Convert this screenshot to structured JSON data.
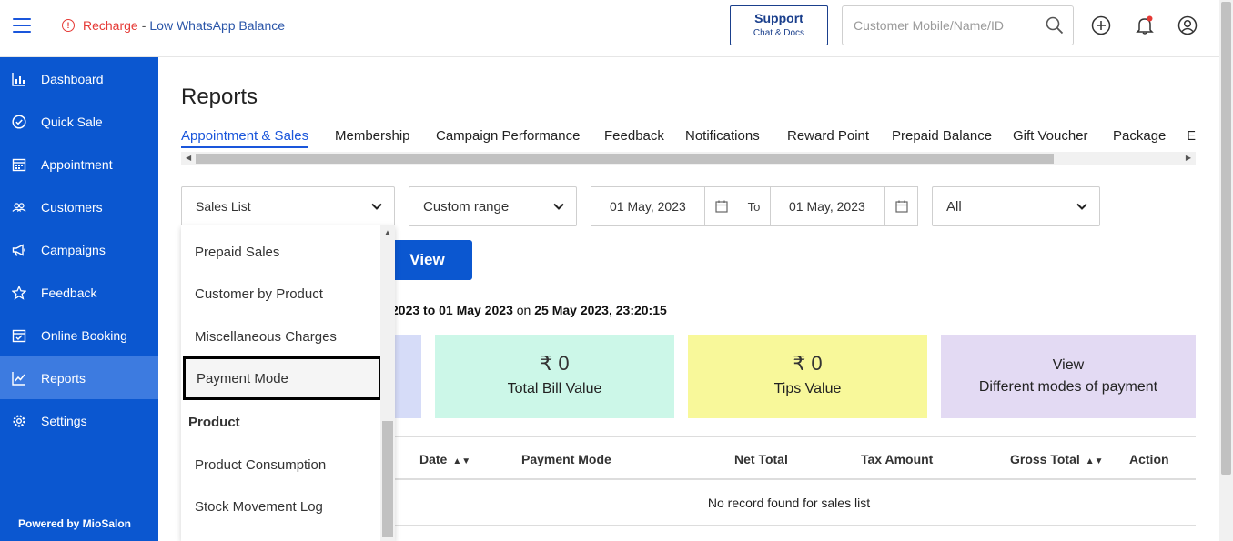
{
  "alert": {
    "prefix": "Recharge",
    "separator": "-",
    "text": "Low WhatsApp Balance"
  },
  "support": {
    "title": "Support",
    "subtitle": "Chat & Docs"
  },
  "search": {
    "placeholder": "Customer Mobile/Name/ID"
  },
  "sidebar": {
    "items": [
      {
        "label": "Dashboard",
        "icon": "bar-chart-icon"
      },
      {
        "label": "Quick Sale",
        "icon": "check-circle-icon"
      },
      {
        "label": "Appointment",
        "icon": "calendar-icon"
      },
      {
        "label": "Customers",
        "icon": "users-icon"
      },
      {
        "label": "Campaigns",
        "icon": "megaphone-icon"
      },
      {
        "label": "Feedback",
        "icon": "star-icon"
      },
      {
        "label": "Online Booking",
        "icon": "calendar-check-icon"
      },
      {
        "label": "Reports",
        "icon": "trend-chart-icon",
        "active": true
      },
      {
        "label": "Settings",
        "icon": "gear-icon"
      }
    ],
    "footer": "Powered by MioSalon"
  },
  "main": {
    "title": "Reports",
    "tabs": [
      {
        "label": "Appointment & Sales",
        "active": true
      },
      {
        "label": "Membership"
      },
      {
        "label": "Campaign Performance"
      },
      {
        "label": "Feedback"
      },
      {
        "label": "Notifications"
      },
      {
        "label": "Reward Point"
      },
      {
        "label": "Prepaid Balance"
      },
      {
        "label": "Gift Voucher"
      },
      {
        "label": "Package"
      },
      {
        "label": "E"
      }
    ],
    "filters": {
      "report_type": "Sales List",
      "range_type": "Custom range",
      "from_date": "01 May, 2023",
      "to_label": "To",
      "to_date": "01 May, 2023",
      "staff": "All"
    },
    "view_button": "View",
    "range_info": {
      "text": "2023 to 01 May 2023",
      "on": "on",
      "timestamp": "25 May 2023, 23:20:15"
    },
    "cards": [
      {
        "amount": "₹ 0",
        "label": "Total Bill Value",
        "color": "#ccf7e8"
      },
      {
        "amount": "₹ 0",
        "label": "Tips Value",
        "color": "#f8f89a"
      },
      {
        "line1": "View",
        "line2": "Different modes of payment",
        "color": "#e3daf3"
      }
    ],
    "table": {
      "columns": [
        "Date",
        "Payment Mode",
        "Net Total",
        "Tax Amount",
        "Gross Total",
        "Action"
      ],
      "empty_message": "No record found for sales list"
    }
  },
  "dropdown": {
    "items": [
      "Prepaid Sales",
      "Customer by Product",
      "Miscellaneous Charges",
      "Payment Mode"
    ],
    "selected": "Payment Mode",
    "group": "Product",
    "group_items": [
      "Product Consumption",
      "Stock Movement Log"
    ]
  },
  "colors": {
    "primary": "#0b57d0",
    "sidebar_active": "#3d7be0",
    "alert_red": "#e53935"
  }
}
